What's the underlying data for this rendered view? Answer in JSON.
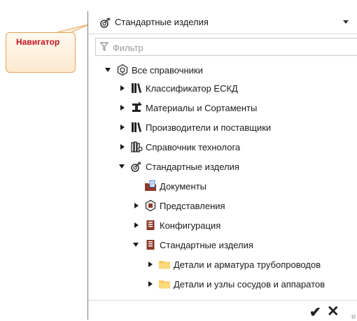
{
  "callout": {
    "label": "Навигатор"
  },
  "header": {
    "title": "Стандартные изделия",
    "icon": "standard-parts-icon"
  },
  "filter": {
    "placeholder": "Фильтр",
    "value": "",
    "icon": "funnel-icon"
  },
  "tree": {
    "root": {
      "label": "Все справочники",
      "icon": "catalog-root-icon",
      "state": "expanded"
    },
    "items": [
      {
        "label": "Классификатор ЕСКД",
        "icon": "books-icon",
        "state": "collapsed"
      },
      {
        "label": "Материалы и Сортаменты",
        "icon": "materials-icon",
        "state": "collapsed"
      },
      {
        "label": "Производители и поставщики",
        "icon": "books-icon",
        "state": "collapsed"
      },
      {
        "label": "Справочник технолога",
        "icon": "technologist-icon",
        "state": "collapsed"
      },
      {
        "label": "Стандартные изделия",
        "icon": "standard-parts-icon",
        "state": "expanded"
      }
    ],
    "std_children": [
      {
        "label": "Документы",
        "icon": "documents-folder-icon",
        "state": "none"
      },
      {
        "label": "Представления",
        "icon": "view-icon",
        "state": "collapsed"
      },
      {
        "label": "Конфигурация",
        "icon": "book-icon",
        "state": "collapsed"
      },
      {
        "label": "Стандартные изделия",
        "icon": "book-icon",
        "state": "expanded"
      }
    ],
    "std_grandchildren": [
      {
        "label": "Детали и арматура трубопроводов",
        "icon": "folder-icon",
        "state": "collapsed"
      },
      {
        "label": "Детали и узлы сосудов и аппаратов",
        "icon": "folder-icon",
        "state": "collapsed"
      }
    ]
  },
  "footer": {
    "ok_glyph": "✔",
    "cancel_glyph": "✕"
  },
  "colors": {
    "callout_border": "#e8a25a",
    "callout_text": "#c1121f",
    "folder": "#f7c65a",
    "book": "#8b3a2a"
  }
}
